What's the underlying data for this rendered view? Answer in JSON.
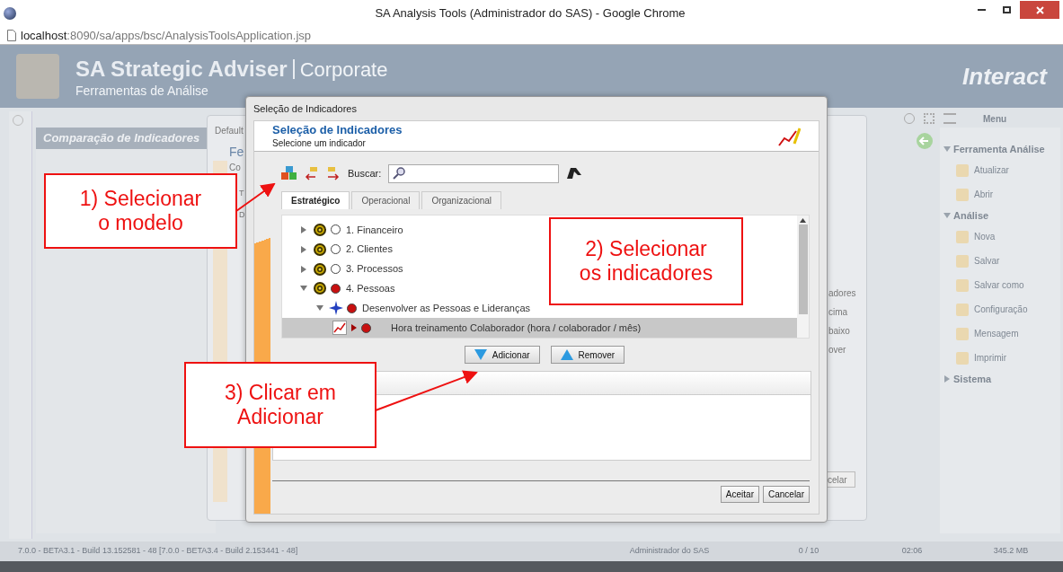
{
  "browser": {
    "title": "SA Analysis Tools (Administrador do SAS) - Google Chrome",
    "url_host": "localhost",
    "url_rest": ":8090/sa/apps/bsc/AnalysisToolsApplication.jsp"
  },
  "app": {
    "brand": "SA Strategic Adviser",
    "edition": "Corporate",
    "subtitle": "Ferramentas de Análise",
    "logo": "Interact"
  },
  "left_panel": {
    "title": "Comparação de Indicadores"
  },
  "menu": {
    "title": "Menu",
    "sections": [
      {
        "label": "Ferramenta Análise",
        "expanded": true,
        "items": [
          "Atualizar",
          "Abrir"
        ]
      },
      {
        "label": "Análise",
        "expanded": true,
        "items": [
          "Nova",
          "Salvar",
          "Salvar como",
          "Configuração",
          "Mensagem",
          "Imprimir"
        ]
      },
      {
        "label": "Sistema",
        "expanded": false
      }
    ]
  },
  "back_dialog": {
    "title": "Default",
    "fragments": [
      "Fe",
      "Co",
      "T",
      "D"
    ],
    "labels": [
      "adores",
      "cima",
      "baixo",
      "over"
    ],
    "button": "celar"
  },
  "dialog": {
    "title": "Seleção de Indicadores",
    "heading": "Seleção de Indicadores",
    "subheading": "Selecione um indicador",
    "search_label": "Buscar:",
    "tabs": [
      {
        "label": "Estratégico",
        "selected": true
      },
      {
        "label": "Operacional",
        "selected": false
      },
      {
        "label": "Organizacional",
        "selected": false
      }
    ],
    "tree": [
      {
        "kind": "perspective",
        "label": "1. Financeiro",
        "color": "#ffffff",
        "expanded": false,
        "selected": false
      },
      {
        "kind": "perspective",
        "label": "2. Clientes",
        "color": "#ffffff",
        "expanded": false,
        "selected": false
      },
      {
        "kind": "perspective",
        "label": "3. Processos",
        "color": "#ffffff",
        "expanded": false,
        "selected": false
      },
      {
        "kind": "perspective",
        "label": "4. Pessoas",
        "color": "#c81010",
        "expanded": true,
        "selected": false,
        "children": [
          {
            "kind": "objective",
            "label": "Desenvolver as Pessoas e Lideranças",
            "color": "#c81010",
            "expanded": true,
            "selected": false,
            "children": [
              {
                "kind": "indicator",
                "label": "Hora treinamento Colaborador (hora / colaborador / mês)",
                "color": "#c81010",
                "selected": true
              }
            ]
          }
        ]
      }
    ],
    "buttons": [
      {
        "kind": "add",
        "label": "Adicionar"
      },
      {
        "kind": "remove",
        "label": "Remover"
      }
    ],
    "footer_buttons": [
      "Aceitar",
      "Cancelar"
    ]
  },
  "callouts": [
    {
      "lines": [
        "1) Selecionar",
        "o modelo"
      ]
    },
    {
      "lines": [
        "2) Selecionar",
        "os indicadores"
      ]
    },
    {
      "lines": [
        "3) Clicar em",
        "Adicionar"
      ]
    }
  ],
  "status_bar": {
    "version": "7.0.0 - BETA3.1 - Build 13.152581 - 48 [7.0.0 - BETA3.4 - Build 2.153441 - 48]",
    "user": "Administrador do SAS",
    "count": "0 / 10",
    "time": "02:06",
    "memory": "345.2 MB"
  }
}
